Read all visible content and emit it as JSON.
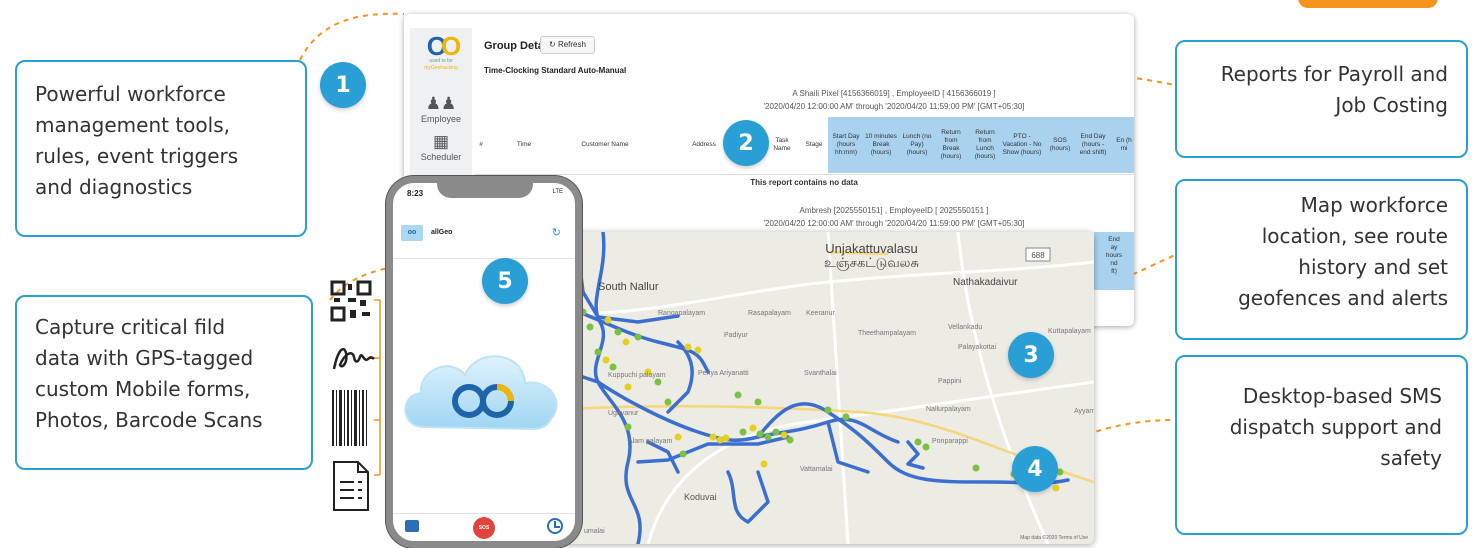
{
  "callouts": {
    "c1": {
      "line1": "Powerful workforce",
      "line2": "management tools,",
      "line3": "rules, event triggers",
      "line4": "and diagnostics"
    },
    "c2": {
      "line1": "Reports for Payroll and",
      "line2": "Job Costing"
    },
    "c3": {
      "line1": "Map workforce",
      "line2": "location, see route",
      "line3": "history and set",
      "line4": "geofences and alerts"
    },
    "c4": {
      "line1": "Desktop-based SMS",
      "line2": "dispatch support and",
      "line3": "safety"
    },
    "c5": {
      "line1": "Capture critical fild",
      "line2": "data with GPS-tagged",
      "line3": "custom Mobile forms,",
      "line4": "Photos, Barcode Scans"
    }
  },
  "badges": [
    "1",
    "2",
    "3",
    "4",
    "5"
  ],
  "report": {
    "logo_sub1": "used to be",
    "logo_sub2": "myGeotracking",
    "nav": [
      "Employee",
      "Scheduler"
    ],
    "title": "Group Detail",
    "refresh_label": "Refresh",
    "report_name": "Time-Clocking Standard Auto-Manual",
    "emp1_name": "A Shaili Pixel [4156366019] , EmployeeID [ 4156366019 ]",
    "emp1_range": "'2020/04/20 12:00:00 AM' through '2020/04/20 11:59:00 PM' [GMT+05:30]",
    "columns": [
      "#",
      "Time",
      "Customer Name",
      "Address",
      "Task Name",
      "Stage",
      "Start Day (hours hh:mm)",
      "10 minutes Break (hours)",
      "Lunch (no Pay) (hours)",
      "Return from Break (hours)",
      "Return from Lunch (hours)",
      "PTO - Vacation - No Show (hours)",
      "SOS (hours)",
      "End Day (hours - end shift)",
      "En (h mi"
    ],
    "no_data": "This report contains no data",
    "emp2_name": "Ambresh [2025550151] , EmployeeID [ 2025550151 ]",
    "emp2_range": "'2020/04/20 12:00:00 AM' through '2020/04/20 11:59:00 PM' [GMT+05:30]",
    "col_partial": [
      "End",
      "ay",
      "hours",
      "nd",
      "ft)"
    ],
    "col_partial2": [
      "En",
      "(h",
      "mi"
    ]
  },
  "map": {
    "places": {
      "unjakattuvalasu": "Unjakattuvalasu",
      "unjakattuvalasu_ta": "உஞ்சகட்டுவலசு",
      "south_nallur": "South Nallur",
      "nathakadaivur": "Nathakadaivur",
      "rangapalayam": "Rangapalayam",
      "rasapalayam": "Rasapalayam",
      "keeranur": "Keeranur",
      "padiyur": "Padiyur",
      "theethampalayam": "Theethampalayam",
      "vellankadu": "Vellankadu",
      "kuttapalayam": "Kuttapalayam",
      "palayakottai": "Palayakottai",
      "kuppuchi": "Kuppuchi palayam",
      "periya": "Periya Ariyanatti",
      "svanthalai": "Svanthalai",
      "pappini": "Pappini",
      "ugayanur": "Ugayanur",
      "nallurpalayam": "Nallurpalayam",
      "ayyam": "Ayyam",
      "ponparappi": "Ponparappi",
      "alampalayam": "Alam palayam",
      "vattamalai": "Vattamalai",
      "koduvai": "Koduvai",
      "kodumalai": "umalai"
    },
    "road_shield": "688",
    "credit": "Map data ©2020   Terms of Use"
  },
  "phone": {
    "time": "8:23",
    "status": "LTE",
    "app_name": "allGeo",
    "sos": "SOS"
  },
  "colors": {
    "accent": "#2a9fd6",
    "route": "#3b6fcf",
    "orange": "#f7941d"
  }
}
